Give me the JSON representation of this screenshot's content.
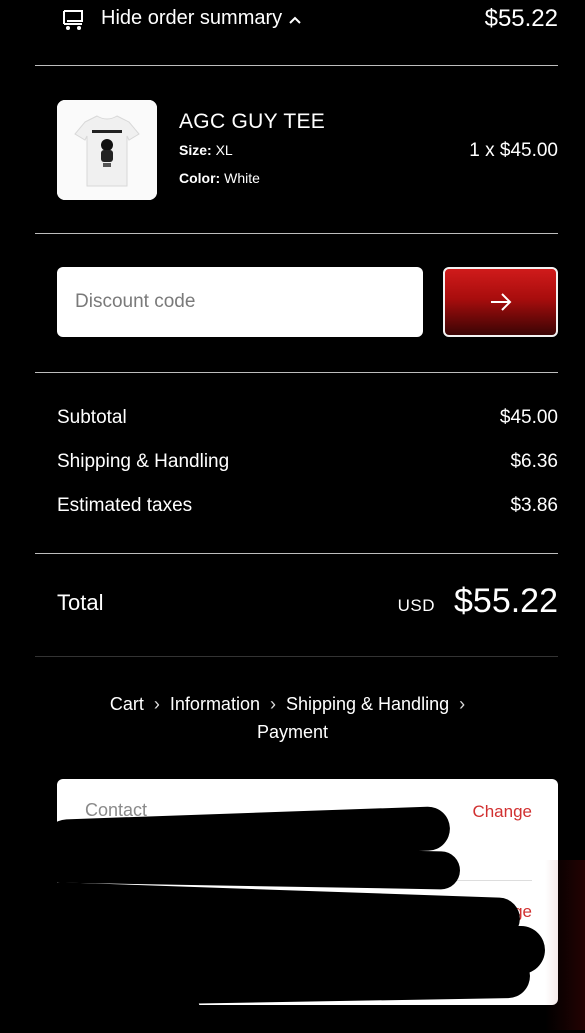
{
  "header": {
    "toggle_label": "Hide order summary",
    "total": "$55.22"
  },
  "product": {
    "name": "AGC GUY TEE",
    "size_label": "Size:",
    "size_value": "XL",
    "color_label": "Color:",
    "color_value": "White",
    "qty_price": "1 x $45.00"
  },
  "discount": {
    "placeholder": "Discount code"
  },
  "summary": {
    "rows": [
      {
        "label": "Subtotal",
        "value": "$45.00"
      },
      {
        "label": "Shipping & Handling",
        "value": "$6.36"
      },
      {
        "label": "Estimated taxes",
        "value": "$3.86"
      }
    ],
    "total_label": "Total",
    "currency": "USD",
    "total": "$55.22"
  },
  "breadcrumb": {
    "items": [
      "Cart",
      "Information",
      "Shipping & Handling",
      "Payment"
    ]
  },
  "contact": {
    "label": "Contact",
    "change_1": "Change",
    "change_2": "Change"
  },
  "colors": {
    "background": "#000000",
    "accent_red": "#c41616",
    "change_link": "#d13030"
  }
}
